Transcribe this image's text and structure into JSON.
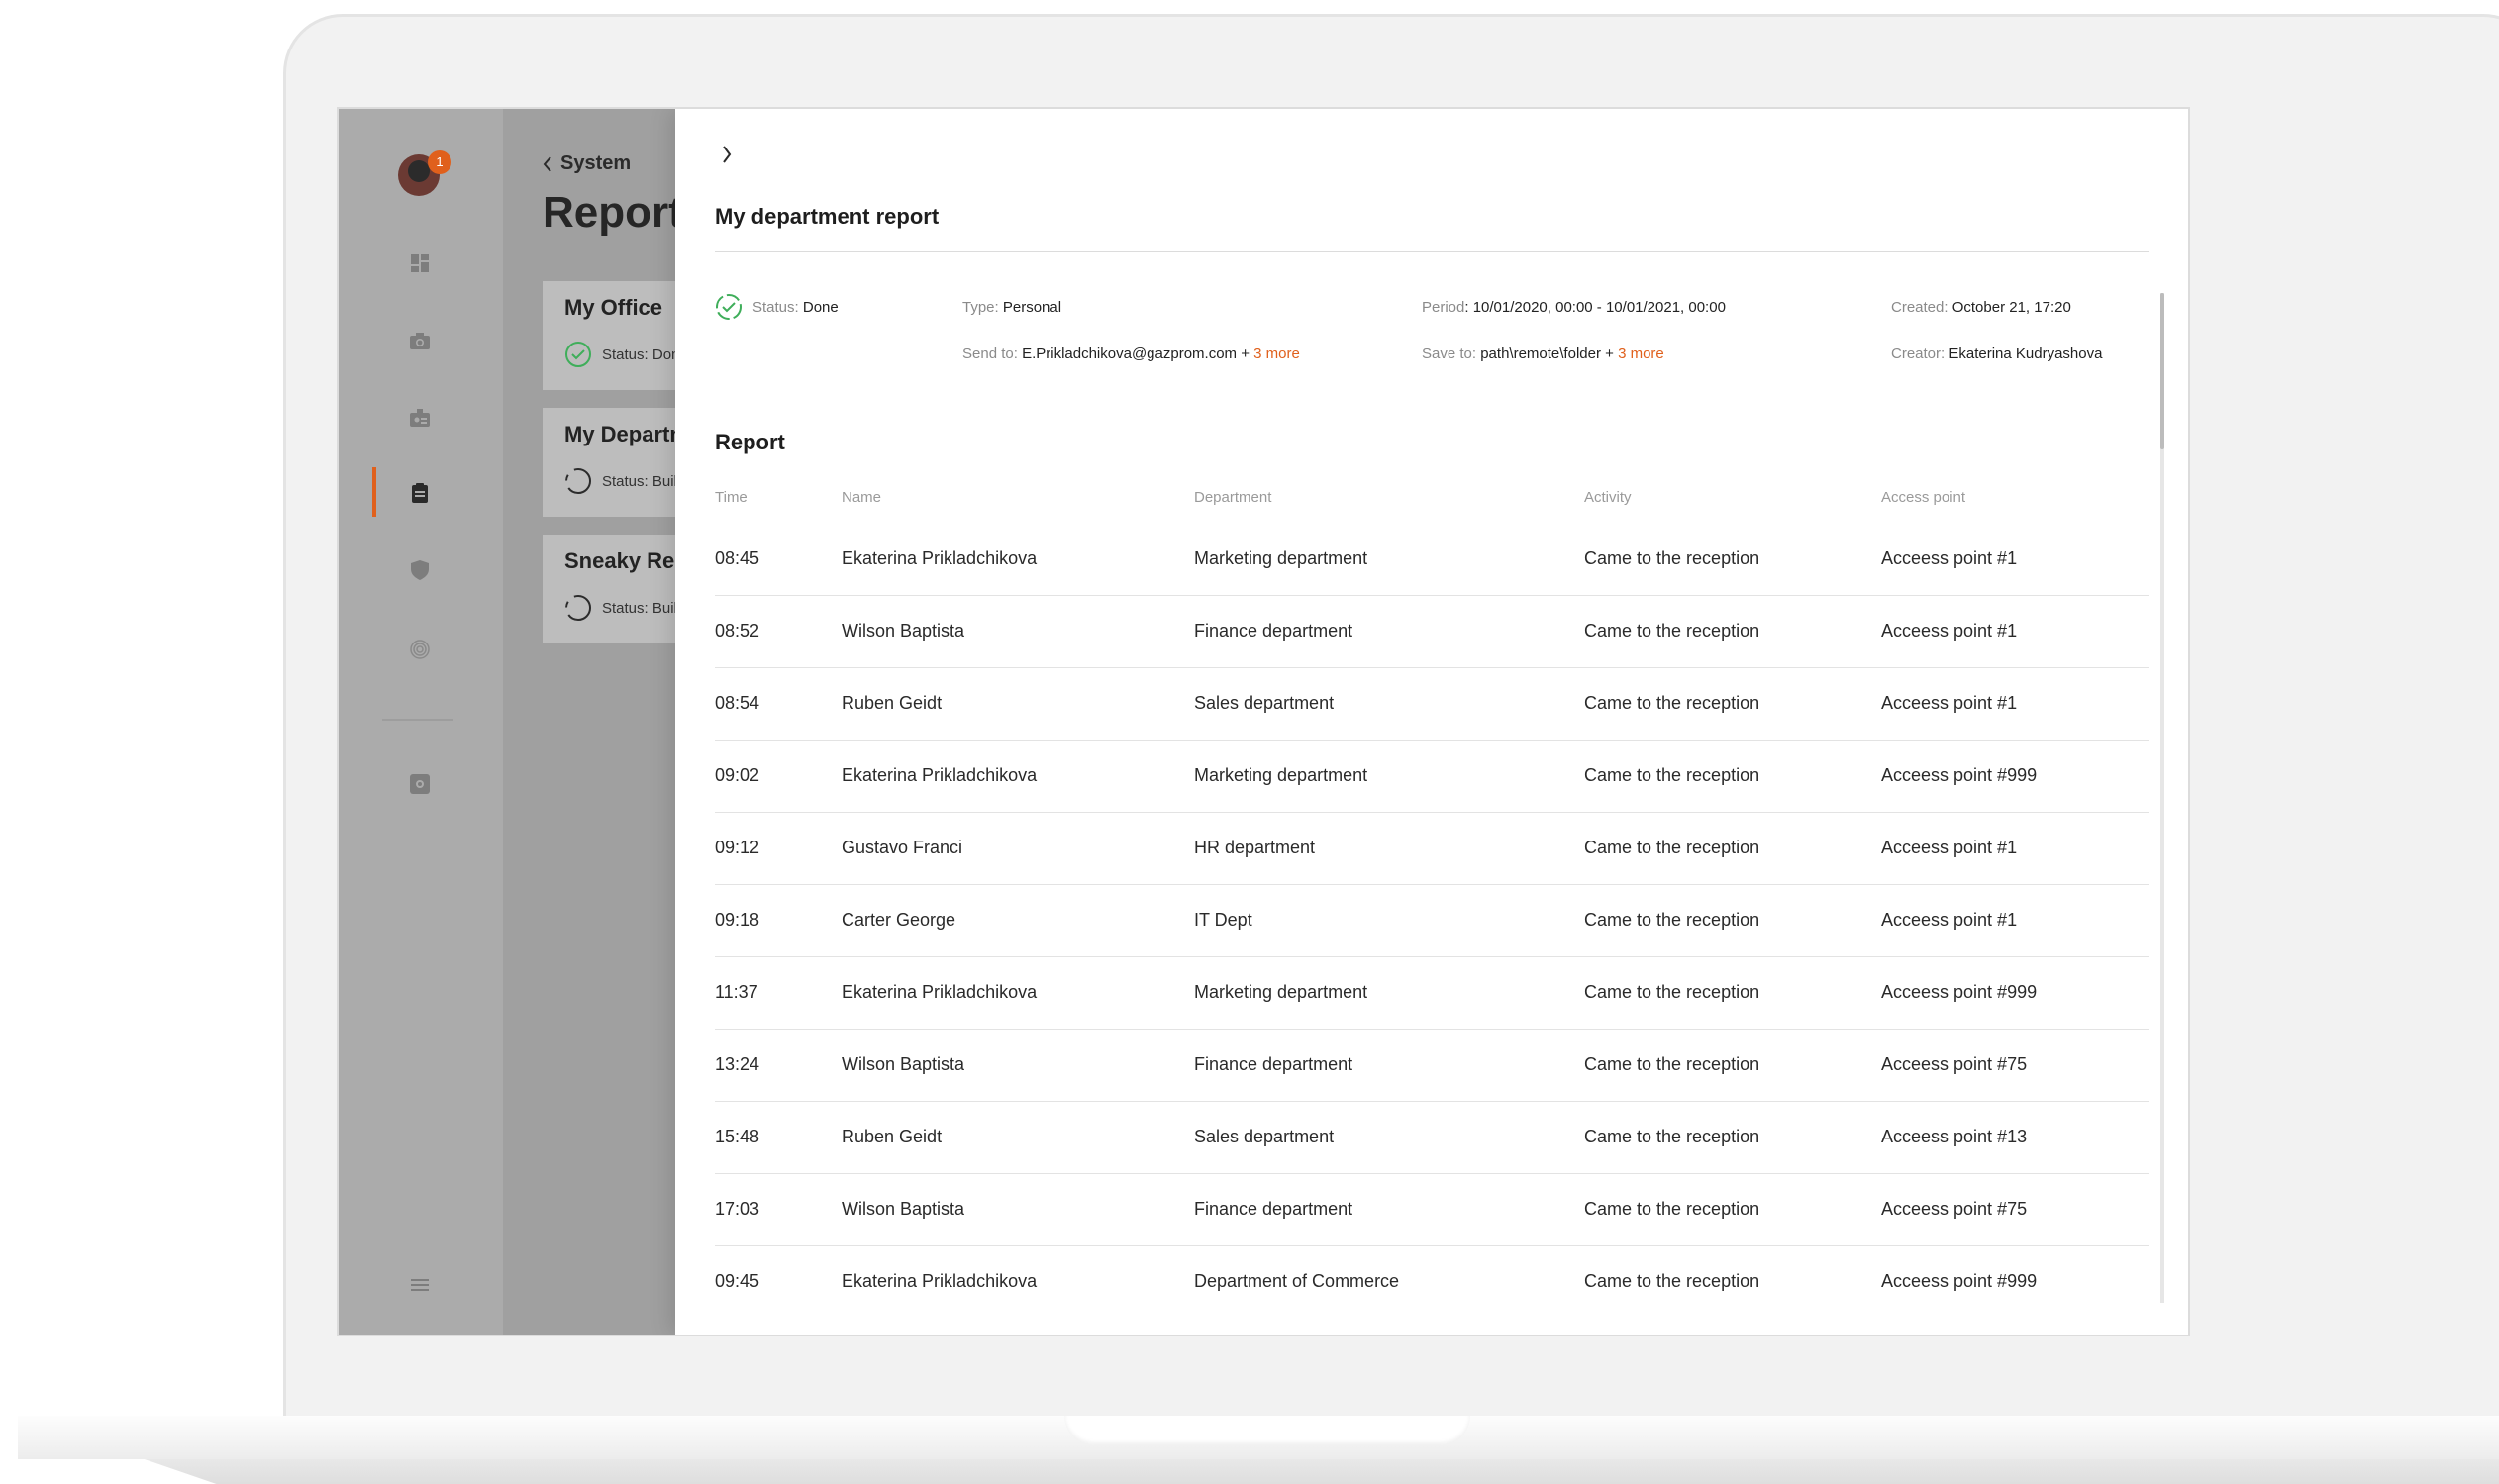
{
  "user": {
    "notification_count": "1"
  },
  "list": {
    "back_label": "System",
    "title": "Reports",
    "cards": [
      {
        "name": "My Office",
        "status": "Status: Done"
      },
      {
        "name": "My Department",
        "status": "Status: Building"
      },
      {
        "name": "Sneaky Report",
        "status": "Status: Building"
      }
    ]
  },
  "detail": {
    "title": "My department report",
    "status_key": "Status:",
    "status_value": "Done",
    "type_key": "Type:",
    "type_value": "Personal",
    "send_key": "Send to:",
    "send_value": "E.Prikladchikova@gazprom.com +",
    "send_more": "3 more",
    "period_key": "Period",
    "period_value": ": 10/01/2020, 00:00 - 10/01/2021, 00:00",
    "save_key": "Save to:",
    "save_value": "path\\remote\\folder +",
    "save_more": "3 more",
    "created_key": "Created:",
    "created_value": "October 21, 17:20",
    "creator_key": "Creator:",
    "creator_value": "Ekaterina Kudryashova",
    "section_title": "Report"
  },
  "table": {
    "columns": [
      "Time",
      "Name",
      "Department",
      "Activity",
      "Access point"
    ],
    "rows": [
      [
        "08:45",
        "Ekaterina Prikladchikova",
        "Marketing department",
        "Came to the reception",
        "Acceess point #1"
      ],
      [
        "08:52",
        "Wilson Baptista",
        "Finance department",
        "Came to the reception",
        "Acceess point #1"
      ],
      [
        "08:54",
        "Ruben Geidt",
        "Sales department",
        "Came to the reception",
        "Acceess point #1"
      ],
      [
        "09:02",
        "Ekaterina Prikladchikova",
        "Marketing department",
        "Came to the reception",
        "Acceess point #999"
      ],
      [
        "09:12",
        "Gustavo Franci",
        "HR department",
        "Came to the reception",
        "Acceess point #1"
      ],
      [
        "09:18",
        "Carter George",
        "IT Dept",
        "Came to the reception",
        "Acceess point #1"
      ],
      [
        "11:37",
        "Ekaterina Prikladchikova",
        "Marketing department",
        "Came to the reception",
        "Acceess point #999"
      ],
      [
        "13:24",
        "Wilson Baptista",
        "Finance department",
        "Came to the reception",
        "Acceess point #75"
      ],
      [
        "15:48",
        "Ruben Geidt",
        "Sales department",
        "Came to the reception",
        "Acceess point #13"
      ],
      [
        "17:03",
        "Wilson Baptista",
        "Finance department",
        "Came to the reception",
        "Acceess point #75"
      ],
      [
        "09:45",
        "Ekaterina Prikladchikova",
        "Department of Commerce",
        "Came to the reception",
        "Acceess point #999"
      ]
    ]
  },
  "colors": {
    "accent": "#e0601c",
    "done_green": "#3fae5a",
    "rail": "#ababab"
  }
}
